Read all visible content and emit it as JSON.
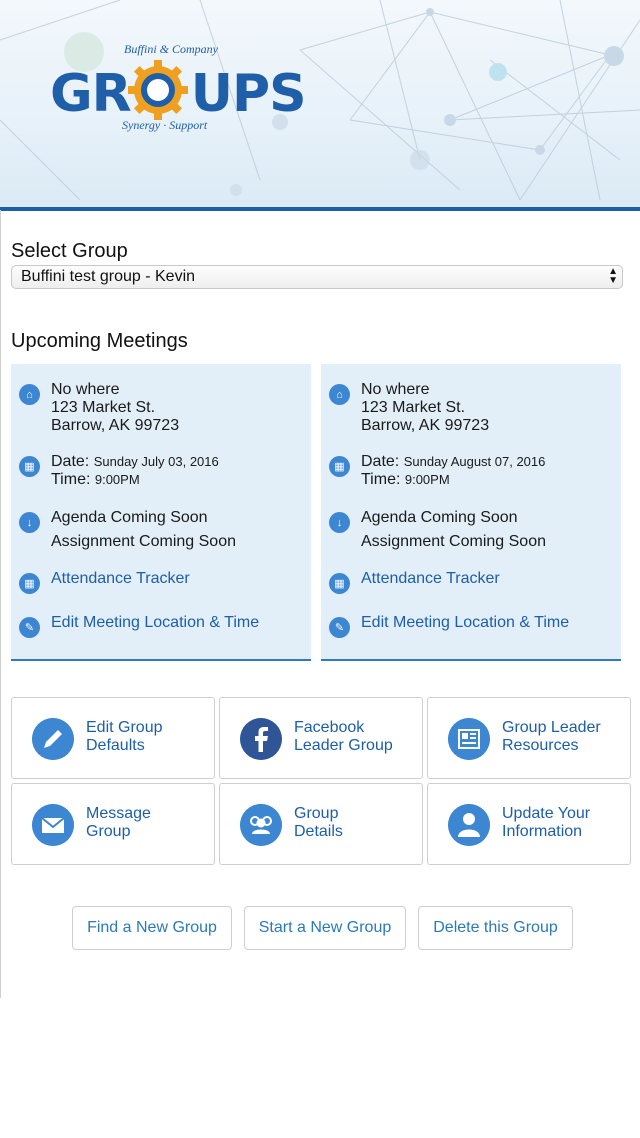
{
  "logo": {
    "title": "GROUPS",
    "top_text": "Buffini & Company",
    "bottom_text": "Synergy · Support"
  },
  "select_group": {
    "label": "Select Group",
    "selected": "Buffini test group - Kevin"
  },
  "upcoming": {
    "title": "Upcoming Meetings",
    "meetings": [
      {
        "location_name": "No where",
        "street": "123 Market St.",
        "city": "Barrow, AK 99723",
        "date_label": "Date:",
        "date": "Sunday July 03, 2016",
        "time_label": "Time:",
        "time": "9:00PM",
        "agenda": "Agenda Coming Soon",
        "assignment": "Assignment Coming Soon",
        "attendance": "Attendance Tracker",
        "edit": "Edit Meeting Location & Time"
      },
      {
        "location_name": "No where",
        "street": "123 Market St.",
        "city": "Barrow, AK 99723",
        "date_label": "Date:",
        "date": "Sunday August 07, 2016",
        "time_label": "Time:",
        "time": "9:00PM",
        "agenda": "Agenda Coming Soon",
        "assignment": "Assignment Coming Soon",
        "attendance": "Attendance Tracker",
        "edit": "Edit Meeting Location & Time"
      }
    ]
  },
  "tiles": [
    {
      "line1": "Edit Group",
      "line2": "Defaults",
      "icon": "pencil-icon"
    },
    {
      "line1": "Facebook",
      "line2": "Leader Group",
      "icon": "facebook-icon"
    },
    {
      "line1": "Group Leader",
      "line2": "Resources",
      "icon": "document-icon"
    },
    {
      "line1": "Message",
      "line2": "Group",
      "icon": "envelope-icon"
    },
    {
      "line1": "Group",
      "line2": "Details",
      "icon": "people-icon"
    },
    {
      "line1": "Update Your",
      "line2": "Information",
      "icon": "user-icon"
    }
  ],
  "buttons": {
    "find": "Find a New Group",
    "start": "Start a New Group",
    "delete": "Delete this Group"
  },
  "colors": {
    "accent": "#1d5ea8",
    "icon_blue": "#3c86d2",
    "card_bg": "#e2eff8",
    "header_bar": "#1b5fa9"
  }
}
